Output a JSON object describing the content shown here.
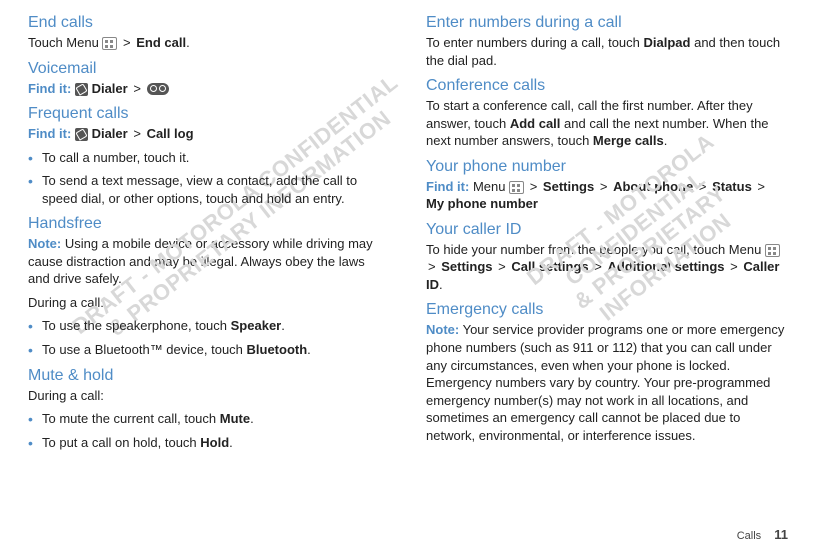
{
  "watermark": {
    "line1": "DRAFT - MOTOROLA CONFIDENTIAL",
    "line2": "& PROPRIETARY INFORMATION"
  },
  "left": {
    "sec1": {
      "title": "End calls",
      "body_a": "Touch Menu ",
      "body_b": " > ",
      "end_call": "End call",
      "body_c": "."
    },
    "sec2": {
      "title": "Voicemail",
      "find": "Find it:",
      "dialer": "Dialer",
      "gt": ">"
    },
    "sec3": {
      "title": "Frequent calls",
      "find": "Find it:",
      "dialer": "Dialer",
      "gt": ">",
      "calllog": "Call log",
      "b1": "To call a number, touch it.",
      "b2": "To send a text message, view a contact, add the call to speed dial, or other options, touch and hold an entry."
    },
    "sec4": {
      "title": "Handsfree",
      "note": "Note:",
      "body": " Using a mobile device or accessory while driving may cause distraction and may be illegal. Always obey the laws and drive safely.",
      "during": "During a call:",
      "b1a": "To use the speakerphone, touch ",
      "b1b": "Speaker",
      "b1c": ".",
      "b2a": "To use a Bluetooth™ device, touch ",
      "b2b": "Bluetooth",
      "b2c": "."
    },
    "sec5": {
      "title": "Mute & hold",
      "during": "During a call:",
      "b1a": "To mute the current call, touch ",
      "b1b": "Mute",
      "b1c": ".",
      "b2a": "To put a call on hold, touch ",
      "b2b": "Hold",
      "b2c": "."
    }
  },
  "right": {
    "sec1": {
      "title": "Enter numbers during a call",
      "body_a": "To enter numbers during a call, touch ",
      "dialpad": "Dialpad",
      "body_b": " and then touch the dial pad."
    },
    "sec2": {
      "title": "Conference calls",
      "body_a": "To start a conference call, call the first number. After they answer, touch ",
      "addcall": "Add call",
      "body_b": " and call the next number. When the next number answers, touch ",
      "merge": "Merge calls",
      "body_c": "."
    },
    "sec3": {
      "title": "Your phone number",
      "find": "Find it:",
      "p_a": " Menu ",
      "gt": ">",
      "settings": "Settings",
      "about": "About phone",
      "status": "Status",
      "mynum": "My phone number"
    },
    "sec4": {
      "title": "Your caller ID",
      "p_a": "To hide your number from the people you call, touch Menu ",
      "gt": ">",
      "settings": "Settings",
      "callset": "Call settings",
      "addl": "Additional settings",
      "cid": "Caller ID",
      "dot": "."
    },
    "sec5": {
      "title": "Emergency calls",
      "note": "Note:",
      "body": " Your service provider programs one or more emergency phone numbers (such as 911 or 112) that you can call under any circumstances, even when your phone is locked. Emergency numbers vary by country. Your pre-programmed emergency number(s) may not work in all locations, and sometimes an emergency call cannot be placed due to network, environmental, or interference issues."
    }
  },
  "footer": {
    "section": "Calls",
    "page": "11"
  }
}
